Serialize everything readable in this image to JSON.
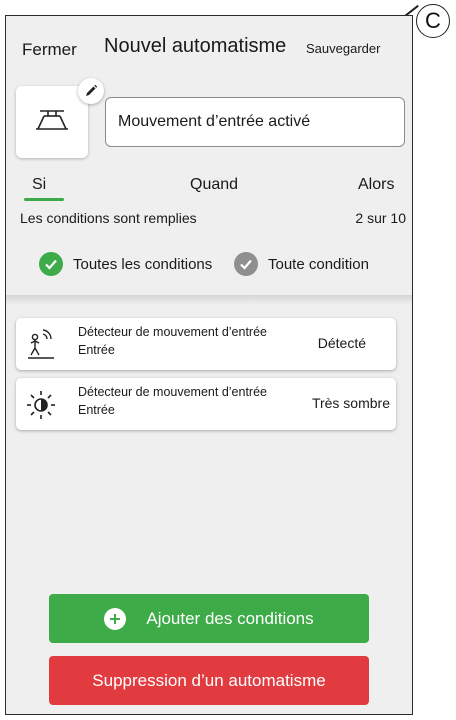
{
  "callout": {
    "label": "C"
  },
  "header": {
    "close_label": "Fermer",
    "title": "Nouvel automatisme",
    "save_label": "Sauvegarder"
  },
  "automation": {
    "name": "Mouvement d’entrée activé",
    "icon": "ceiling-light-icon"
  },
  "tabs": [
    {
      "label": "Si",
      "active": true
    },
    {
      "label": "Quand",
      "active": false
    },
    {
      "label": "Alors",
      "active": false
    }
  ],
  "conditions": {
    "summary": "Les conditions sont remplies",
    "count": "2 sur 10",
    "options": [
      {
        "label": "Toutes les conditions",
        "selected": true
      },
      {
        "label": "Toute condition",
        "selected": false
      }
    ],
    "items": [
      {
        "icon": "motion-sensor-icon",
        "name": "Détecteur de mouvement d’entrée",
        "room": "Entrée",
        "state": "Détecté"
      },
      {
        "icon": "brightness-icon",
        "name": "Détecteur de mouvement d’entrée",
        "room": "Entrée",
        "state": "Très sombre"
      }
    ]
  },
  "actions": {
    "add_label": "Ajouter des conditions",
    "delete_label": "Suppression d’un automatisme"
  },
  "colors": {
    "accent_green": "#3dab48",
    "danger_red": "#e13b3f",
    "inactive_grey": "#8f8f8f"
  }
}
